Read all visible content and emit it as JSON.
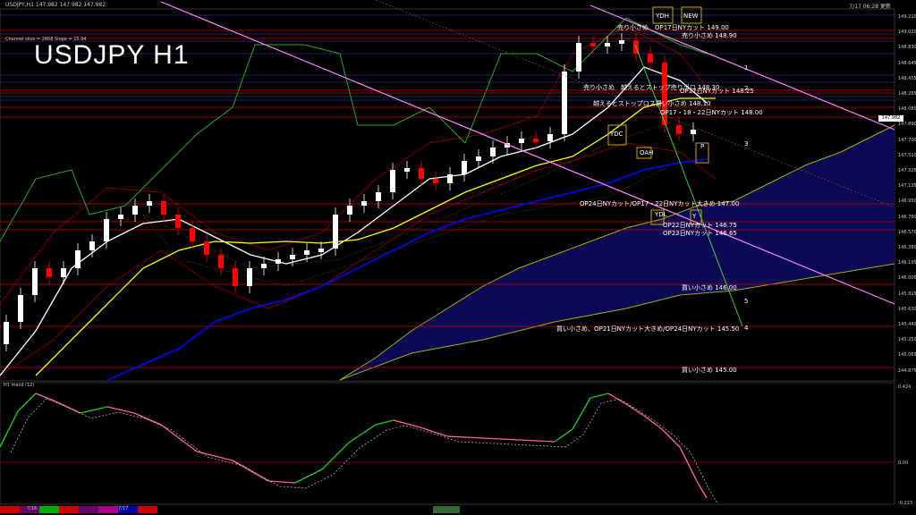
{
  "header": {
    "symbol_label": "USDJPY,H1 147.982 147.982 147.982",
    "time_label": "7/17 06:28 更新",
    "title": "USDJPY H1",
    "channel_info": "Channel slice = 2868 Slope = 15.94",
    "macd_label": "H1 macd (12)"
  },
  "price_axis": {
    "ticks": [
      "149.210",
      "149.020",
      "148.830",
      "148.645",
      "148.455",
      "148.265",
      "148.080",
      "147.890",
      "147.700",
      "147.510",
      "147.325",
      "147.135",
      "146.950",
      "146.760",
      "146.570",
      "146.380",
      "146.195",
      "146.005",
      "145.815",
      "145.630",
      "145.440",
      "145.250",
      "145.065",
      "144.875"
    ],
    "current_price": "147.982"
  },
  "macd_axis": {
    "ticks": [
      "0.424",
      "0.00",
      "-0.223"
    ]
  },
  "levels": [
    {
      "text": "売り小さめ　OP17日NYカット 149.00",
      "color": "#ffffff"
    },
    {
      "text": "売り小さめ 148.90",
      "color": "#ffffff"
    },
    {
      "text": "売り小さめ　越えるとストップ売りポロ 148.30",
      "color": "#ffffff"
    },
    {
      "text": "OP17日NYカット 148.25",
      "color": "#ffffff"
    },
    {
      "text": "越えるとストップロス買い小さめ 148.10",
      "color": "#ffffff"
    },
    {
      "text": "OP17・18・22日NYカット 148.00",
      "color": "#ffffff"
    },
    {
      "text": "OP24日NYカット/OP17・22日NYカット大きめ 147.00",
      "color": "#ffffff"
    },
    {
      "text": "OP22日NYカット 146.75",
      "color": "#ffffff"
    },
    {
      "text": "OP23日NYカット 146.65",
      "color": "#ffffff"
    },
    {
      "text": "買い小さめ 146.00",
      "color": "#ffffff"
    },
    {
      "text": "買い小さめ、OP21日NYカット大きめ/OP24日NYカット 145.50",
      "color": "#ffffff"
    },
    {
      "text": "買い小さめ 145.00",
      "color": "#ffffff"
    }
  ],
  "box_labels": {
    "ydh": "YDH",
    "ydl": "YDL",
    "ydc": "YDC",
    "new": "NEW",
    "oah": "OAH",
    "p": "P",
    "y": "Y"
  },
  "channel_marks": [
    "1",
    "2",
    "3",
    "4",
    "5"
  ],
  "time_bar": {
    "labels": [
      "7/16",
      "7/17"
    ]
  },
  "colors": {
    "background": "#000000",
    "bull_candle": "#ffffff",
    "bear_candle": "#ff0000",
    "ma_fast": "#ffffff",
    "ma_mid": "#ffff00",
    "ma_slow": "#0000ff",
    "channel": "#ff80ff",
    "kumo": "#1a1a6e",
    "macd_main": "#22cc22",
    "macd_down": "#ff6699",
    "level_line": "#cc0000",
    "upper_line": "#4444cc"
  }
}
